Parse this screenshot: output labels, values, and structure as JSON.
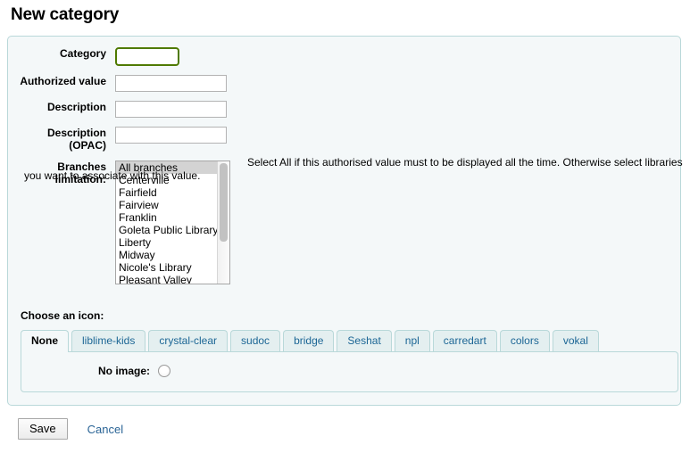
{
  "page": {
    "title": "New category"
  },
  "form": {
    "fields": [
      {
        "label": "Category",
        "label_line2": "",
        "value": "",
        "placeholder": "",
        "name": "category"
      },
      {
        "label": "Authorized value",
        "label_line2": "",
        "value": "",
        "placeholder": "",
        "name": "authorized-value"
      },
      {
        "label": "Description",
        "label_line2": "",
        "value": "",
        "placeholder": "",
        "name": "description"
      },
      {
        "label": "Description",
        "label_line2": "(OPAC)",
        "value": "",
        "placeholder": "",
        "name": "description-opac"
      }
    ],
    "branches": {
      "label_line1": "Branches",
      "label_line2": "limitation:",
      "options": [
        "All branches",
        "Centerville",
        "Fairfield",
        "Fairview",
        "Franklin",
        "Goleta Public Library",
        "Liberty",
        "Midway",
        "Nicole's Library",
        "Pleasant Valley"
      ],
      "selected": "All branches"
    },
    "hint_line1": "Select All if this authorised value must to be displayed all the time. Otherwise select libraries",
    "hint_line2": "you want to associate with this value."
  },
  "icon_section": {
    "heading": "Choose an icon:",
    "tabs": [
      {
        "label": "None",
        "active": true
      },
      {
        "label": "liblime-kids",
        "active": false
      },
      {
        "label": "crystal-clear",
        "active": false
      },
      {
        "label": "sudoc",
        "active": false
      },
      {
        "label": "bridge",
        "active": false
      },
      {
        "label": "Seshat",
        "active": false
      },
      {
        "label": "npl",
        "active": false
      },
      {
        "label": "carredart",
        "active": false
      },
      {
        "label": "colors",
        "active": false
      },
      {
        "label": "vokal",
        "active": false
      }
    ],
    "panel": {
      "no_image_label": "No image:",
      "no_image_selected": false
    }
  },
  "actions": {
    "save_label": "Save",
    "cancel_label": "Cancel"
  },
  "colors": {
    "focus_border": "#4f7a00",
    "fieldset_border": "#b9d8d9",
    "fieldset_bg": "#f4f8f9",
    "link": "#2a6496",
    "tab_text": "#1c6695"
  }
}
